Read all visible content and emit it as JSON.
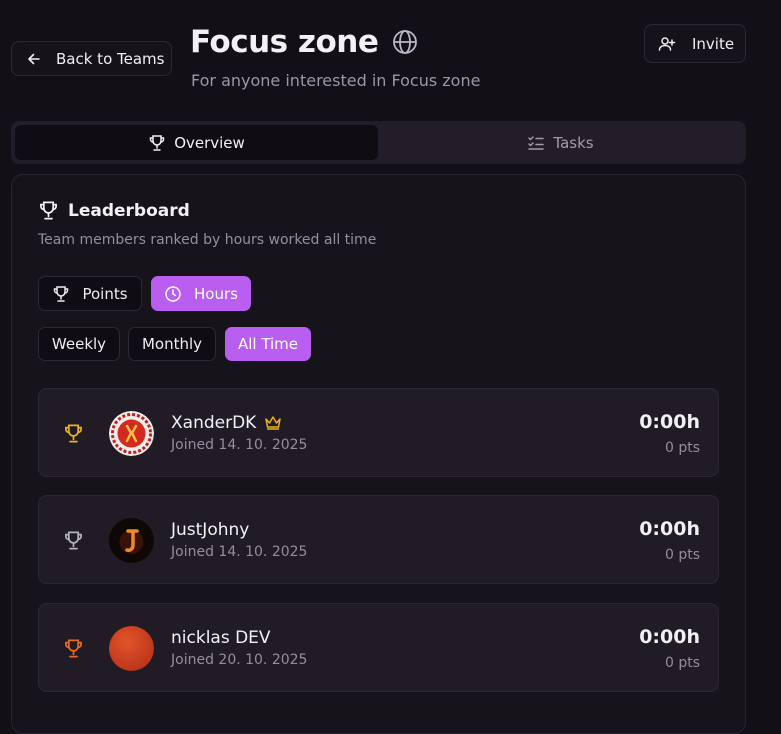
{
  "header": {
    "back_label": "Back to Teams",
    "title": "Focus zone",
    "subtitle": "For anyone interested in Focus zone",
    "invite_label": "Invite"
  },
  "tabs": [
    {
      "label": "Overview",
      "active": true,
      "icon": "trophy-icon"
    },
    {
      "label": "Tasks",
      "active": false,
      "icon": "list-checks-icon"
    }
  ],
  "leaderboard": {
    "title": "Leaderboard",
    "description": "Team members ranked by hours worked all time",
    "metric_toggle": [
      {
        "label": "Points",
        "active": false,
        "icon": "trophy-icon"
      },
      {
        "label": "Hours",
        "active": true,
        "icon": "clock-icon"
      }
    ],
    "period_toggle": [
      {
        "label": "Weekly",
        "active": false
      },
      {
        "label": "Monthly",
        "active": false
      },
      {
        "label": "All Time",
        "active": true
      }
    ],
    "members": [
      {
        "name": "XanderDK",
        "joined": "Joined 14. 10. 2025",
        "hours": "0:00h",
        "points": "0 pts",
        "owner": true,
        "trophy_color": "#e8b21c",
        "avatar": "red-emblem-avatar"
      },
      {
        "name": "JustJohny",
        "joined": "Joined 14. 10. 2025",
        "hours": "0:00h",
        "points": "0 pts",
        "owner": false,
        "trophy_color": "#b5b0bd",
        "avatar": "fire-letter-avatar"
      },
      {
        "name": "nicklas DEV",
        "joined": "Joined 20. 10. 2025",
        "hours": "0:00h",
        "points": "0 pts",
        "owner": false,
        "trophy_color": "#e86a1e",
        "avatar": "orange-circle-avatar"
      }
    ]
  },
  "colors": {
    "background": "#130f17",
    "accent": "#b95ef0",
    "owner_crown": "#e8b21c"
  }
}
